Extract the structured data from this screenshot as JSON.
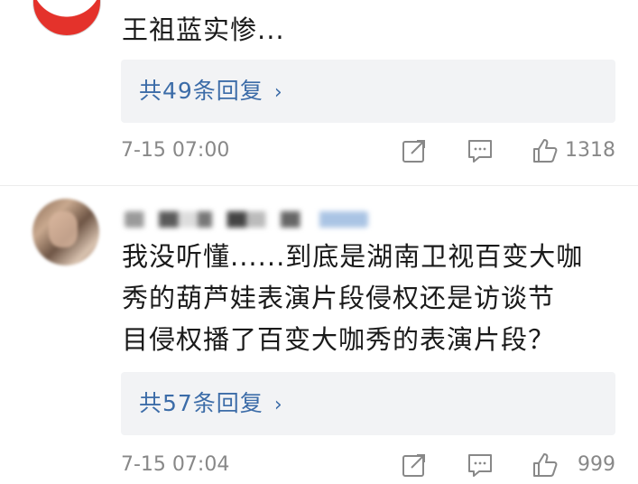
{
  "comments": [
    {
      "text": "王祖蓝实惨...",
      "reply_label": "共49条回复",
      "chevron": "›",
      "time": "7-15 07:00",
      "likes": "1318"
    },
    {
      "text": "我没听懂......到底是湖南卫视百变大咖\n秀的葫芦娃表演片段侵权还是访谈节\n目侵权播了百变大咖秀的表演片段？",
      "reply_label": "共57条回复",
      "chevron": "›",
      "time": "7-15 07:04",
      "likes": "999"
    }
  ],
  "icons": {
    "share": "share-icon",
    "comment": "comment-icon",
    "like": "thumbs-up-icon"
  },
  "colors": {
    "link": "#3c6ca8",
    "meta_gray": "#888888",
    "reply_bg": "#f2f3f5",
    "avatar_red": "#e4322b"
  }
}
